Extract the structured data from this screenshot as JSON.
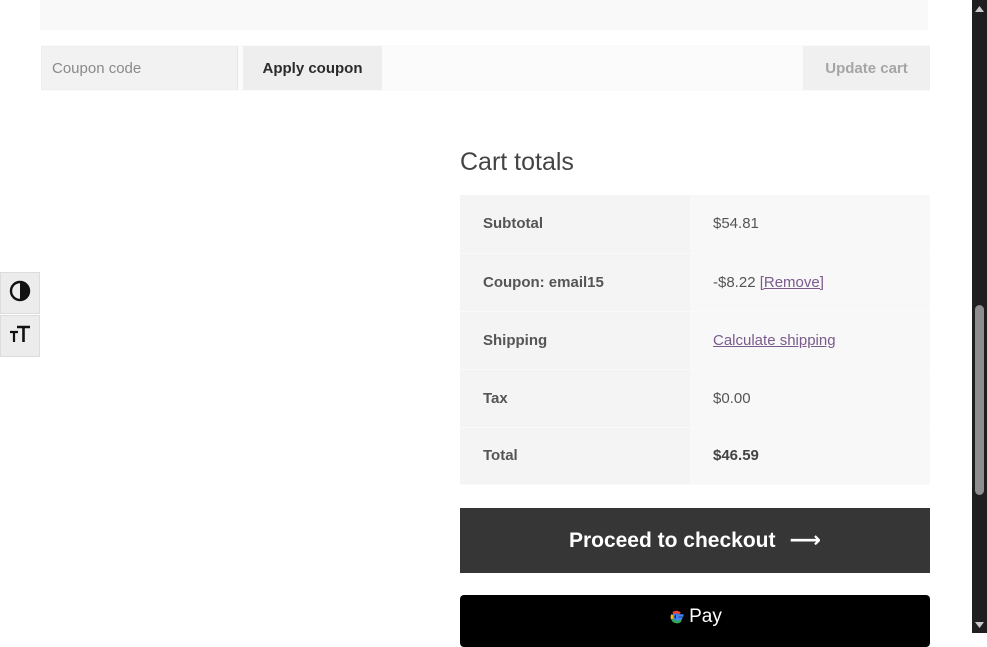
{
  "coupon": {
    "placeholder": "Coupon code",
    "apply_label": "Apply coupon",
    "update_label": "Update cart"
  },
  "accessibility": {
    "contrast_icon": "contrast-icon",
    "text_size_icon": "text-size-icon"
  },
  "cart_totals": {
    "title": "Cart totals",
    "rows": {
      "subtotal": {
        "label": "Subtotal",
        "value": "$54.81"
      },
      "coupon": {
        "label": "Coupon: email15",
        "value": "-$8.22",
        "remove_label": "[Remove]"
      },
      "shipping": {
        "label": "Shipping",
        "link": "Calculate shipping"
      },
      "tax": {
        "label": "Tax",
        "value": "$0.00"
      },
      "total": {
        "label": "Total",
        "value": "$46.59"
      }
    },
    "checkout_label": "Proceed to checkout",
    "checkout_icon": "arrow-right-icon",
    "gpay_label": "Pay",
    "gpay_icon": "google-g-icon"
  },
  "colors": {
    "checkout_bg": "#363636",
    "link": "#7b5a8c",
    "gpay_bg": "#000000"
  }
}
